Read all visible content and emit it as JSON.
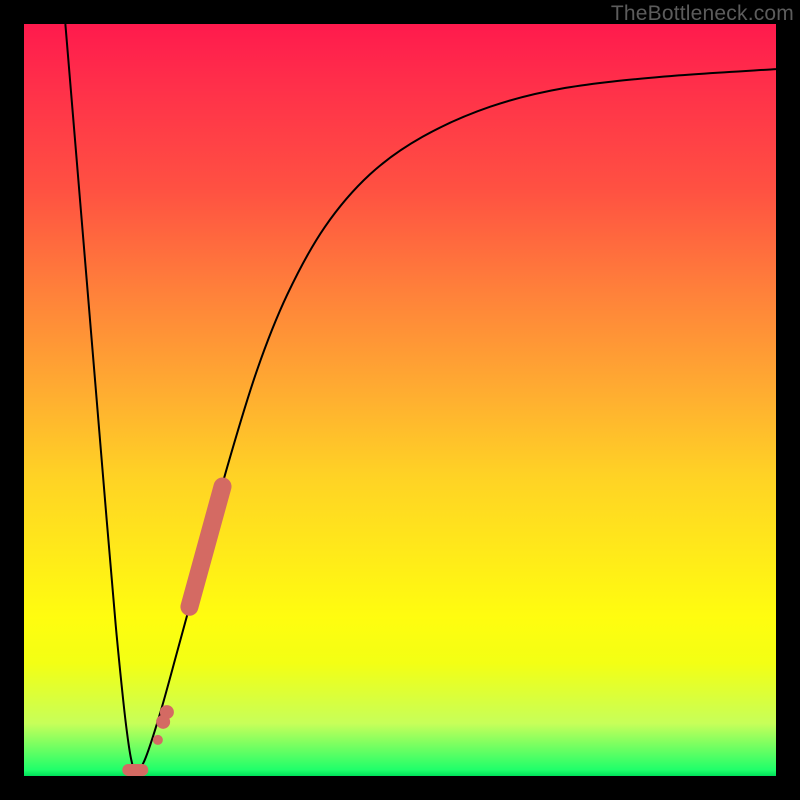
{
  "watermark": "TheBottleneck.com",
  "chart_data": {
    "type": "line",
    "title": "",
    "xlabel": "",
    "ylabel": "",
    "xlim": [
      0,
      100
    ],
    "ylim": [
      0,
      100
    ],
    "grid": false,
    "series": [
      {
        "name": "bottleneck-curve",
        "stroke": "#000000",
        "points": [
          {
            "x": 5.5,
            "y": 100
          },
          {
            "x": 6.5,
            "y": 88
          },
          {
            "x": 8.0,
            "y": 70
          },
          {
            "x": 9.5,
            "y": 52
          },
          {
            "x": 11.0,
            "y": 34
          },
          {
            "x": 12.2,
            "y": 20
          },
          {
            "x": 13.2,
            "y": 10
          },
          {
            "x": 13.8,
            "y": 5
          },
          {
            "x": 14.3,
            "y": 2
          },
          {
            "x": 14.8,
            "y": 0.8
          },
          {
            "x": 16.0,
            "y": 2
          },
          {
            "x": 18.0,
            "y": 8
          },
          {
            "x": 20.5,
            "y": 17
          },
          {
            "x": 23.5,
            "y": 28
          },
          {
            "x": 27.0,
            "y": 41
          },
          {
            "x": 31.0,
            "y": 54
          },
          {
            "x": 35.0,
            "y": 64
          },
          {
            "x": 40.0,
            "y": 73
          },
          {
            "x": 46.0,
            "y": 80
          },
          {
            "x": 53.0,
            "y": 85
          },
          {
            "x": 62.0,
            "y": 89
          },
          {
            "x": 72.0,
            "y": 91.5
          },
          {
            "x": 85.0,
            "y": 93
          },
          {
            "x": 100.0,
            "y": 94
          }
        ]
      },
      {
        "name": "overlay-markers",
        "stroke": "#d46a63",
        "type_hint": "thick-segment-and-points",
        "points": [
          {
            "x": 14.8,
            "y": 0.8
          },
          {
            "x": 17.8,
            "y": 4.8
          },
          {
            "x": 18.5,
            "y": 7.2
          },
          {
            "x": 19.0,
            "y": 8.5
          },
          {
            "x": 22.0,
            "y": 22.5
          },
          {
            "x": 26.4,
            "y": 38.5
          }
        ]
      }
    ],
    "background_gradient": {
      "orientation": "vertical",
      "stops": [
        {
          "pos": 0.0,
          "color": "#ff1a4d"
        },
        {
          "pos": 0.5,
          "color": "#ffb030"
        },
        {
          "pos": 0.8,
          "color": "#fffd0f"
        },
        {
          "pos": 0.99,
          "color": "#1fff6a"
        },
        {
          "pos": 1.0,
          "color": "#00e05a"
        }
      ]
    }
  }
}
